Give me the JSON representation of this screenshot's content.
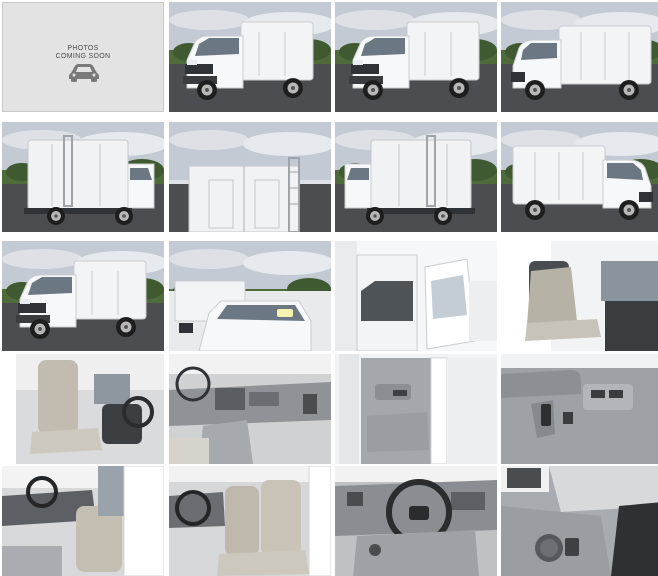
{
  "placeholder": {
    "line1": "PHOTOS",
    "line2": "COMING SOON",
    "icon": "car-icon"
  },
  "photos": [
    {
      "name": "photo-front-left-exterior",
      "kind": "ext-front"
    },
    {
      "name": "photo-front-left-exterior-2",
      "kind": "ext-front"
    },
    {
      "name": "photo-left-side-exterior",
      "kind": "ext-side-left"
    },
    {
      "name": "photo-rear-right-exterior",
      "kind": "ext-rear-right"
    },
    {
      "name": "photo-rear-exterior",
      "kind": "ext-rear"
    },
    {
      "name": "photo-rear-left-exterior",
      "kind": "ext-rear-left"
    },
    {
      "name": "photo-right-side-exterior",
      "kind": "ext-side-right"
    },
    {
      "name": "photo-front-right-exterior",
      "kind": "ext-front-right"
    },
    {
      "name": "photo-hood-windshield",
      "kind": "ext-hood"
    },
    {
      "name": "photo-open-driver-door",
      "kind": "door-open"
    },
    {
      "name": "photo-passenger-seat",
      "kind": "int-seat-light"
    },
    {
      "name": "photo-driver-seat",
      "kind": "int-seat"
    },
    {
      "name": "photo-dashboard-passenger",
      "kind": "int-dash"
    },
    {
      "name": "photo-door-panel",
      "kind": "door-panel"
    },
    {
      "name": "photo-window-switches",
      "kind": "switches"
    },
    {
      "name": "photo-cab-interior",
      "kind": "int-cab"
    },
    {
      "name": "photo-seats-steering",
      "kind": "int-seats"
    },
    {
      "name": "photo-steering-wheel-dash",
      "kind": "int-wheel"
    },
    {
      "name": "photo-headlight-switch",
      "kind": "knob"
    }
  ]
}
